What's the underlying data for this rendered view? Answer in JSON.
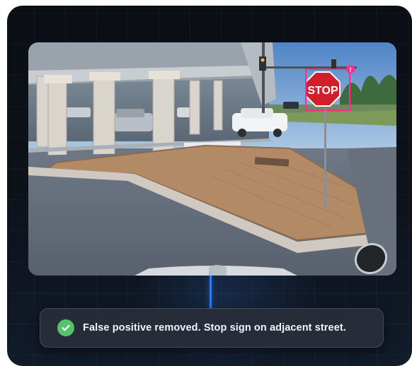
{
  "camera_view": {
    "sign_text": "STOP",
    "detection": {
      "label_color": "#ff2d8a",
      "alert_badge": "!"
    }
  },
  "toast": {
    "icon": "check-circle-icon",
    "icon_color": "#56c26a",
    "message": "False positive removed. Stop sign on adjacent street."
  },
  "colors": {
    "background": "#0b0e14",
    "accent": "#2f7bea",
    "detection_box": "#ff2d8a"
  }
}
